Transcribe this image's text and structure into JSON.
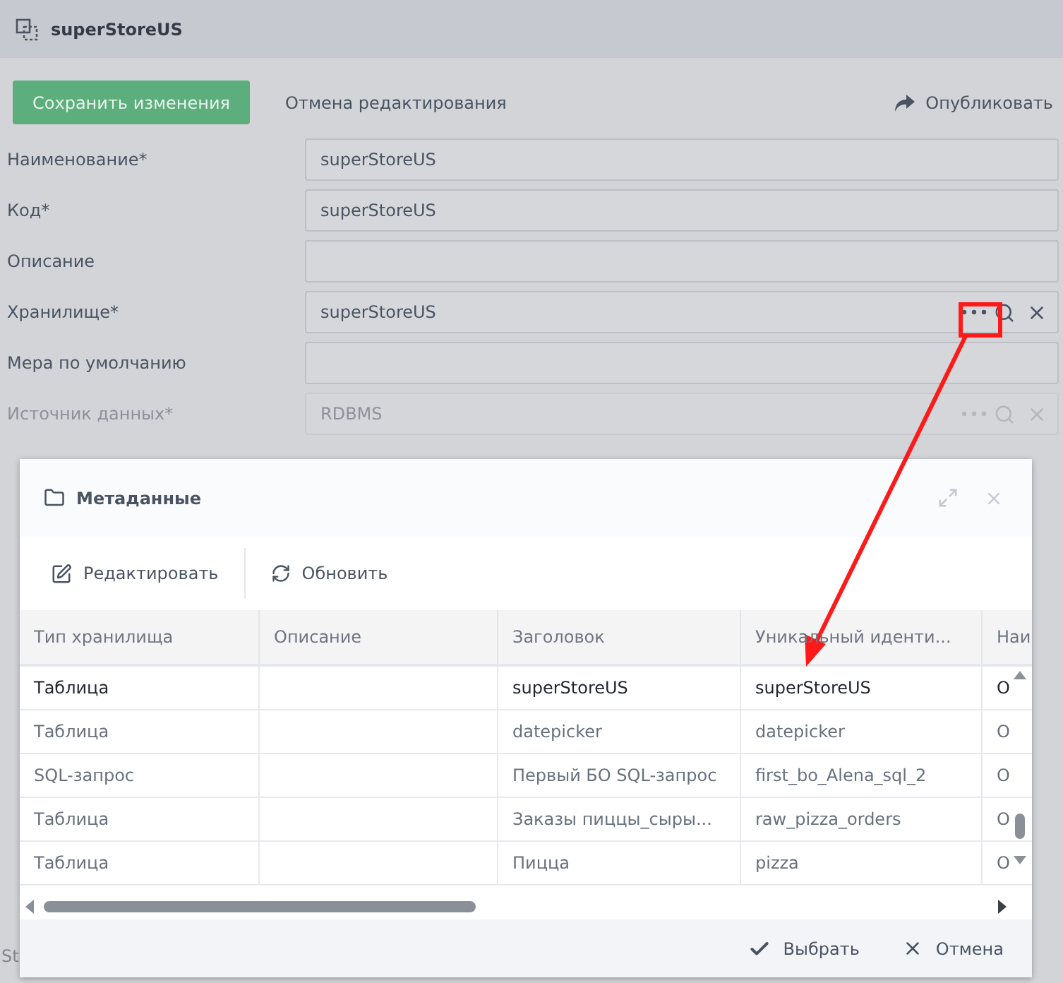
{
  "app": {
    "title": "superStoreUS"
  },
  "toolbar": {
    "save": "Сохранить изменения",
    "cancel": "Отмена редактирования",
    "publish": "Опубликовать"
  },
  "fields": [
    {
      "label": "Наименование*",
      "value": "superStoreUS",
      "kind": "text",
      "disabled": false
    },
    {
      "label": "Код*",
      "value": "superStoreUS",
      "kind": "text",
      "disabled": false
    },
    {
      "label": "Описание",
      "kind": "text",
      "disabled": false
    },
    {
      "label": "Хранилище*",
      "value": "superStoreUS",
      "kind": "lookup",
      "disabled": false
    },
    {
      "label": "Мера по умолчанию",
      "kind": "text",
      "disabled": false
    },
    {
      "label": "Источник данных*",
      "value": "RDBMS",
      "kind": "lookup",
      "disabled": true
    }
  ],
  "footer_text": "St",
  "dialog": {
    "title": "Метаданные",
    "actions": [
      {
        "label": "Редактировать",
        "kind": "edit"
      },
      {
        "label": "Обновить",
        "kind": "refresh"
      }
    ],
    "columns": [
      "Тип хранилища",
      "Описание",
      "Заголовок",
      "Уникальный иденти...",
      "Наи"
    ],
    "rows": [
      {
        "cells": [
          "Таблица",
          "",
          "superStoreUS",
          "superStoreUS",
          "О"
        ],
        "selected": true
      },
      {
        "cells": [
          "Таблица",
          "",
          "datepicker",
          "datepicker",
          "О"
        ],
        "selected": false
      },
      {
        "cells": [
          "SQL-запрос",
          "",
          "Первый БО SQL-запрос",
          "first_bo_Alena_sql_2",
          "О"
        ],
        "selected": false
      },
      {
        "cells": [
          "Таблица",
          "",
          "Заказы пиццы_сыры...",
          "raw_pizza_orders",
          "О"
        ],
        "selected": false
      },
      {
        "cells": [
          "Таблица",
          "",
          "Пицца",
          "pizza",
          "О"
        ],
        "selected": false
      }
    ],
    "buttons": [
      {
        "label": "Выбрать",
        "kind": "ok"
      },
      {
        "label": "Отмена",
        "kind": "cancel"
      }
    ]
  }
}
